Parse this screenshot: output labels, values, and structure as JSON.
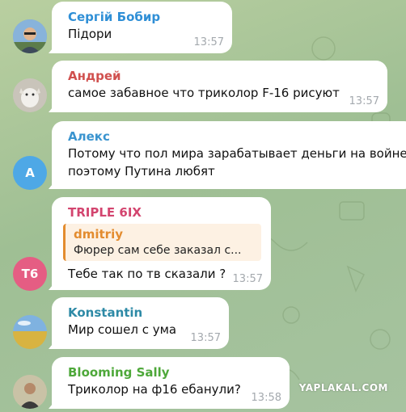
{
  "messages": [
    {
      "sender": "Сергій Бобир",
      "text": "Підори",
      "time": "13:57",
      "name_color": "#2f8fd6",
      "avatar": "photo"
    },
    {
      "sender": "Андрей",
      "text": "самое забавное что триколор F-16 рисуют",
      "time": "13:57",
      "name_color": "#d0504e",
      "avatar": "photo"
    },
    {
      "sender": "Алекс",
      "text_lines": [
        "Потому что пол мира зарабатывает деньги на войне и",
        "поэтому Путина любят"
      ],
      "name_color": "#3a94cf",
      "avatar_initials": "А",
      "avatar_color": "#4ea8e6"
    },
    {
      "sender": "TRIPLE 6IX",
      "reply": {
        "sender": "dmitriy",
        "text": "Фюрер сам себе заказал с..."
      },
      "text": "Тебе так по тв сказали ?",
      "time": "13:57",
      "name_color": "#d3456f",
      "avatar_initials": "T6",
      "avatar_color": "#e55d83"
    },
    {
      "sender": "Konstantin",
      "text": "Мир сошел с ума",
      "time": "13:57",
      "name_color": "#2e8aa6",
      "avatar": "photo"
    },
    {
      "sender": "Blooming Sally",
      "text": "Триколор на ф16 ебанули?",
      "time": "13:58",
      "name_color": "#4ea83a",
      "avatar": "photo"
    }
  ],
  "watermark": "YAPLAKAL.COM"
}
